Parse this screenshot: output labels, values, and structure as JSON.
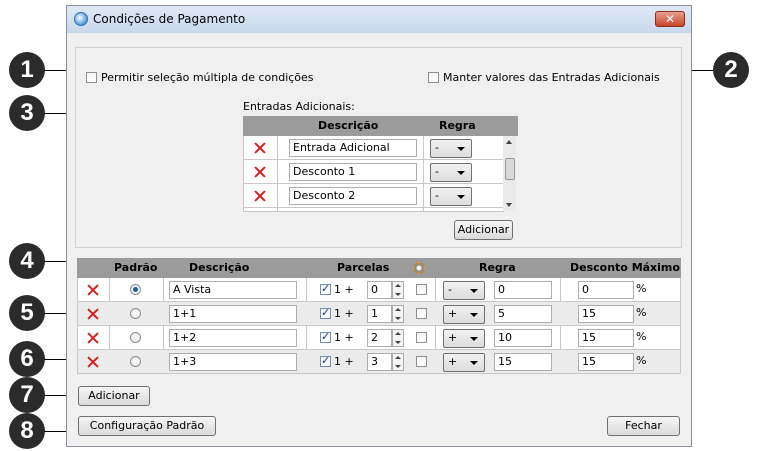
{
  "window": {
    "title": "Condições de Pagamento",
    "close_glyph": "✕"
  },
  "callouts": [
    "1",
    "2",
    "3",
    "4",
    "5",
    "6",
    "7",
    "8"
  ],
  "options": {
    "multi_select_label": "Permitir seleção múltipla de condições",
    "keep_values_label": "Manter valores das Entradas Adicionais"
  },
  "extra_entries": {
    "label": "Entradas Adicionais:",
    "headers": {
      "description": "Descrição",
      "rule": "Regra"
    },
    "rows": [
      {
        "description": "Entrada Adicional",
        "rule": "-"
      },
      {
        "description": "Desconto 1",
        "rule": "-"
      },
      {
        "description": "Desconto 2",
        "rule": "-"
      }
    ],
    "add_label": "Adicionar"
  },
  "conditions": {
    "headers": {
      "default": "Padrão",
      "description": "Descrição",
      "installments": "Parcelas",
      "rule": "Regra",
      "max_discount": "Desconto Máximo"
    },
    "rows": [
      {
        "selected": true,
        "description": "A Vista",
        "installments_checked": true,
        "installments_prefix": "1 +",
        "installments": "0",
        "rule": "-",
        "rule_value": "0",
        "discount": "0",
        "percent": "%"
      },
      {
        "selected": false,
        "description": "1+1",
        "installments_checked": true,
        "installments_prefix": "1 +",
        "installments": "1",
        "rule": "+",
        "rule_value": "5",
        "discount": "15",
        "percent": "%"
      },
      {
        "selected": false,
        "description": "1+2",
        "installments_checked": true,
        "installments_prefix": "1 +",
        "installments": "2",
        "rule": "+",
        "rule_value": "10",
        "discount": "15",
        "percent": "%"
      },
      {
        "selected": false,
        "description": "1+3",
        "installments_checked": true,
        "installments_prefix": "1 +",
        "installments": "3",
        "rule": "+",
        "rule_value": "15",
        "discount": "15",
        "percent": "%"
      }
    ]
  },
  "buttons": {
    "add": "Adicionar",
    "default_config": "Configuração Padrão",
    "close": "Fechar"
  }
}
